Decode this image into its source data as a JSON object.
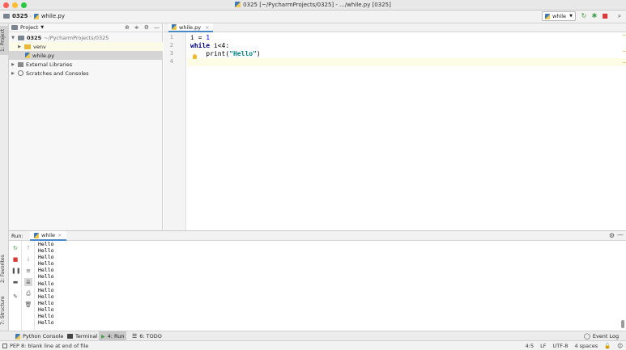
{
  "window": {
    "title": "0325 [~/PycharmProjects/0325] - .../while.py [0325]"
  },
  "navbar": {
    "crumb_project": "0325",
    "crumb_file": "while.py",
    "run_config": "while"
  },
  "left_strip": {
    "project_tab": "1: Project",
    "favorites_tab": "2: Favorites",
    "structure_tab": "7: Structure"
  },
  "project_panel": {
    "header": "Project",
    "tree": [
      {
        "label": "0325",
        "extra": "~/PycharmProjects/0325"
      },
      {
        "label": "venv"
      },
      {
        "label": "while.py"
      },
      {
        "label": "External Libraries"
      },
      {
        "label": "Scratches and Consoles"
      }
    ]
  },
  "editor": {
    "tab_label": "while.py",
    "line_numbers": [
      "1",
      "2",
      "3",
      "4"
    ],
    "lines": {
      "l1_var": "i",
      "l1_op": " = ",
      "l1_num": "1",
      "l2_kw": "while",
      "l2_rest": " i<4:",
      "l3_func": "    print(",
      "l3_str": "\"Hello\"",
      "l3_close": ")"
    }
  },
  "run_panel": {
    "label": "Run:",
    "tab_label": "while",
    "output": "Hello\nHello\nHello\nHello\nHello\nHello\nHello\nHello\nHello\nHello\nHello\nHello\nHello"
  },
  "bottom_tools": {
    "python_console": "Python Console",
    "terminal": "Terminal",
    "run": "4: Run",
    "todo": "6: TODO",
    "event_log": "Event Log"
  },
  "status": {
    "message": "PEP 8: blank line at end of file",
    "position": "4:5",
    "line_sep": "LF",
    "encoding": "UTF-8",
    "indent": "4 spaces"
  }
}
